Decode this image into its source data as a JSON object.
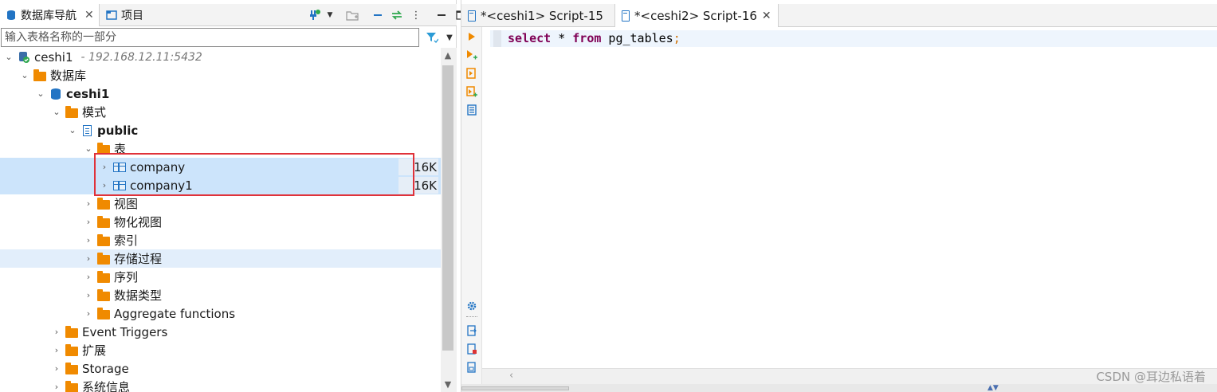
{
  "left_panel": {
    "tabs": [
      {
        "label": "数据库导航",
        "close": "✕"
      },
      {
        "label": "项目"
      }
    ],
    "filter": {
      "placeholder": "输入表格名称的一部分"
    },
    "tree": {
      "connection": {
        "label": "ceshi1",
        "host": "- 192.168.12.11:5432"
      },
      "databases_folder": "数据库",
      "database": "ceshi1",
      "schemas_folder": "模式",
      "schema": "public",
      "tables_folder": "表",
      "tables": [
        {
          "name": "company",
          "size": "16K"
        },
        {
          "name": "company1",
          "size": "16K"
        }
      ],
      "schema_children": [
        "视图",
        "物化视图",
        "索引",
        "存储过程",
        "序列",
        "数据类型",
        "Aggregate functions"
      ],
      "database_children": [
        "Event Triggers",
        "扩展",
        "Storage",
        "系统信息"
      ]
    }
  },
  "editor": {
    "tabs": [
      {
        "label": "*<ceshi1> Script-15"
      },
      {
        "label": "*<ceshi2> Script-16",
        "close": "✕"
      }
    ],
    "code": {
      "kw1": "select",
      "mid1": " * ",
      "kw2": "from",
      "mid2": " pg_tables",
      "end": ";"
    }
  },
  "watermark": "CSDN @耳边私语着"
}
